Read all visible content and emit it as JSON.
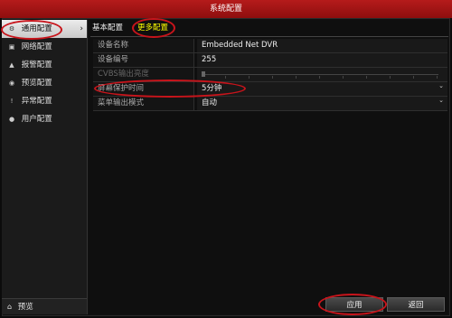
{
  "window": {
    "title": "系统配置"
  },
  "sidebar": {
    "items": [
      {
        "label": "通用配置",
        "icon": "gear-icon",
        "glyph": "⚙",
        "active": true
      },
      {
        "label": "网络配置",
        "icon": "network-icon",
        "glyph": "▣",
        "active": false
      },
      {
        "label": "报警配置",
        "icon": "alarm-icon",
        "glyph": "▲",
        "active": false
      },
      {
        "label": "预览配置",
        "icon": "eye-icon",
        "glyph": "◉",
        "active": false
      },
      {
        "label": "异常配置",
        "icon": "exclamation-icon",
        "glyph": "!",
        "active": false
      },
      {
        "label": "用户配置",
        "icon": "user-icon",
        "glyph": "●",
        "active": false
      }
    ],
    "chevron": "›",
    "preview": {
      "label": "预览",
      "icon": "home-icon",
      "glyph": "⌂"
    }
  },
  "tabs": [
    {
      "label": "基本配置",
      "active": false
    },
    {
      "label": "更多配置",
      "active": true
    }
  ],
  "settings": [
    {
      "label": "设备名称",
      "value": "Embedded Net DVR"
    },
    {
      "label": "设备编号",
      "value": "255"
    },
    {
      "label": "CVBS输出亮度",
      "value": ""
    },
    {
      "label": "屏幕保护时间",
      "value": "5分钟"
    },
    {
      "label": "菜单输出模式",
      "value": "自动"
    }
  ],
  "dropdown_glyph": "⌄",
  "buttons": {
    "apply": "应用",
    "back": "返回"
  },
  "colors": {
    "titlebar": "#a81515",
    "highlight_ring": "#c8141b",
    "active_tab": "#ffff00"
  }
}
